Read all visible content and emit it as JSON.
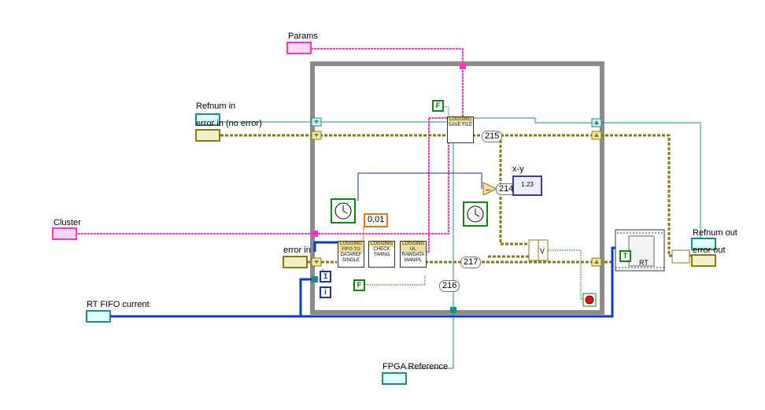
{
  "labels": {
    "params": "Params",
    "refnum_in": "Refnum in",
    "error_in_no_error": "error in (no error)",
    "cluster": "Cluster",
    "error_in": "error in",
    "rt_fifo_current": "RT FIFO current",
    "fpga_reference": "FPGA Reference",
    "refnum_out": "Refnum out",
    "error_out": "error out",
    "xy": "x-y"
  },
  "constants": {
    "c215": "215",
    "c214": "214",
    "c217": "217",
    "c216": "216",
    "c001": "0,01",
    "bool_f_top": "F",
    "bool_f_bottom": "F",
    "bool_t": "T",
    "iter_one": "1",
    "iter_i": "i",
    "xy_indicator": "1.23"
  },
  "subvis": {
    "save_file": {
      "header": "LOGGING",
      "body": "SAVE FILE"
    },
    "fifo_read": {
      "header": "LOGGING FIFO TO",
      "body": "DATAREF SINGLE"
    },
    "check_timing": {
      "header": "LOGGING",
      "body": "CHECK TIMING"
    },
    "ul_rawdata": {
      "header": "LOGGING UL",
      "body": "RAWDATA MANIPL"
    },
    "rt_block": {
      "body": "RT"
    }
  },
  "colors": {
    "loop_border": "#8c8c8c",
    "pink_wire": "#ff33cc",
    "error_wire": "#8a7a10",
    "refnum_wire": "#1a8c8c",
    "blue_wire": "#0a3cc8",
    "bool_wire": "#0a8a0a",
    "stop_button": "#e01010"
  }
}
